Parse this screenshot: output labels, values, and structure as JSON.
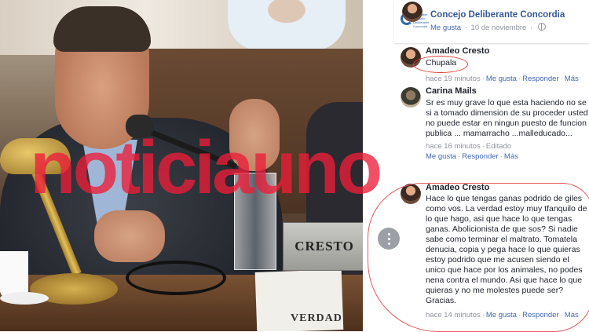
{
  "page_header": {
    "name": "Concejo Deliberante Concordia",
    "logo_text": "Honorable Concejo Deliberante Concordia",
    "like_label": "Me gusta",
    "date": "10 de noviembre"
  },
  "photo": {
    "nameplate": "CRESTO",
    "bottom_text": "VERDAD"
  },
  "watermark": "noticiauno",
  "comments": [
    {
      "author": "Amadeo Cresto",
      "text": "Chupala",
      "time": "hace 19 minutos",
      "actions": [
        "Me gusta",
        "Responder",
        "Más"
      ]
    },
    {
      "author": "Carina Mails",
      "text": "Sr es muy grave lo que esta haciendo no se si a tomado dimension de su proceder usted no puede estar en ningun puesto de funcion publica ... mamarracho ...malleducado...",
      "time": "hace 16 minutos",
      "edited": "Editado",
      "actions": [
        "Me gusta",
        "Responder",
        "Más"
      ]
    },
    {
      "author": "Amadeo Cresto",
      "text": "Hace lo que tengas ganas podrido de giles como vos. La verdad estoy muy tfanquilo de lo que hago, asi que hace lo que tengas ganas. Abolicionista de que sos? Si nadie sabe como terminar el maltrato. Tomatela denucia, copia y pega hace lo que quieras estoy podrido que me acusen siendo el unico que hace por los animales, no podes nena contra el mundo. Asi que hace lo que quieras y no me molestes puede ser? Gracias.",
      "time": "hace 14 minutos",
      "actions": [
        "Me gusta",
        "Responder",
        "Más"
      ]
    }
  ],
  "colors": {
    "link": "#4267b2",
    "page_link": "#365899",
    "meta": "#90949c",
    "watermark": "#ec1e38",
    "annotation": "#e23b3b"
  }
}
